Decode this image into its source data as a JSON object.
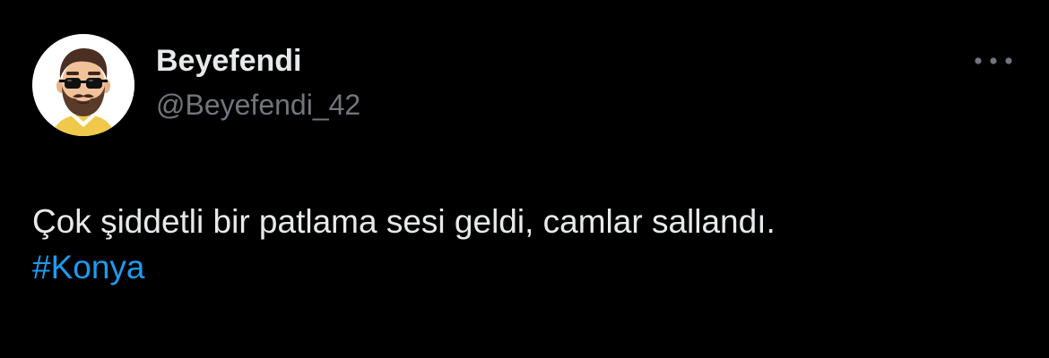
{
  "author": {
    "display_name": "Beyefendi",
    "handle": "@Beyefendi_42",
    "avatar_icon": "bearded-man-sunglasses-avatar-icon"
  },
  "menu": {
    "icon": "more-horizontal-icon"
  },
  "tweet": {
    "text": "Çok şiddetli bir patlama sesi geldi, camlar sallandı.",
    "hashtag": "#Konya"
  },
  "colors": {
    "background": "#000000",
    "primary_text": "#e7e9ea",
    "secondary_text": "#71767b",
    "link": "#1d9bf0"
  }
}
